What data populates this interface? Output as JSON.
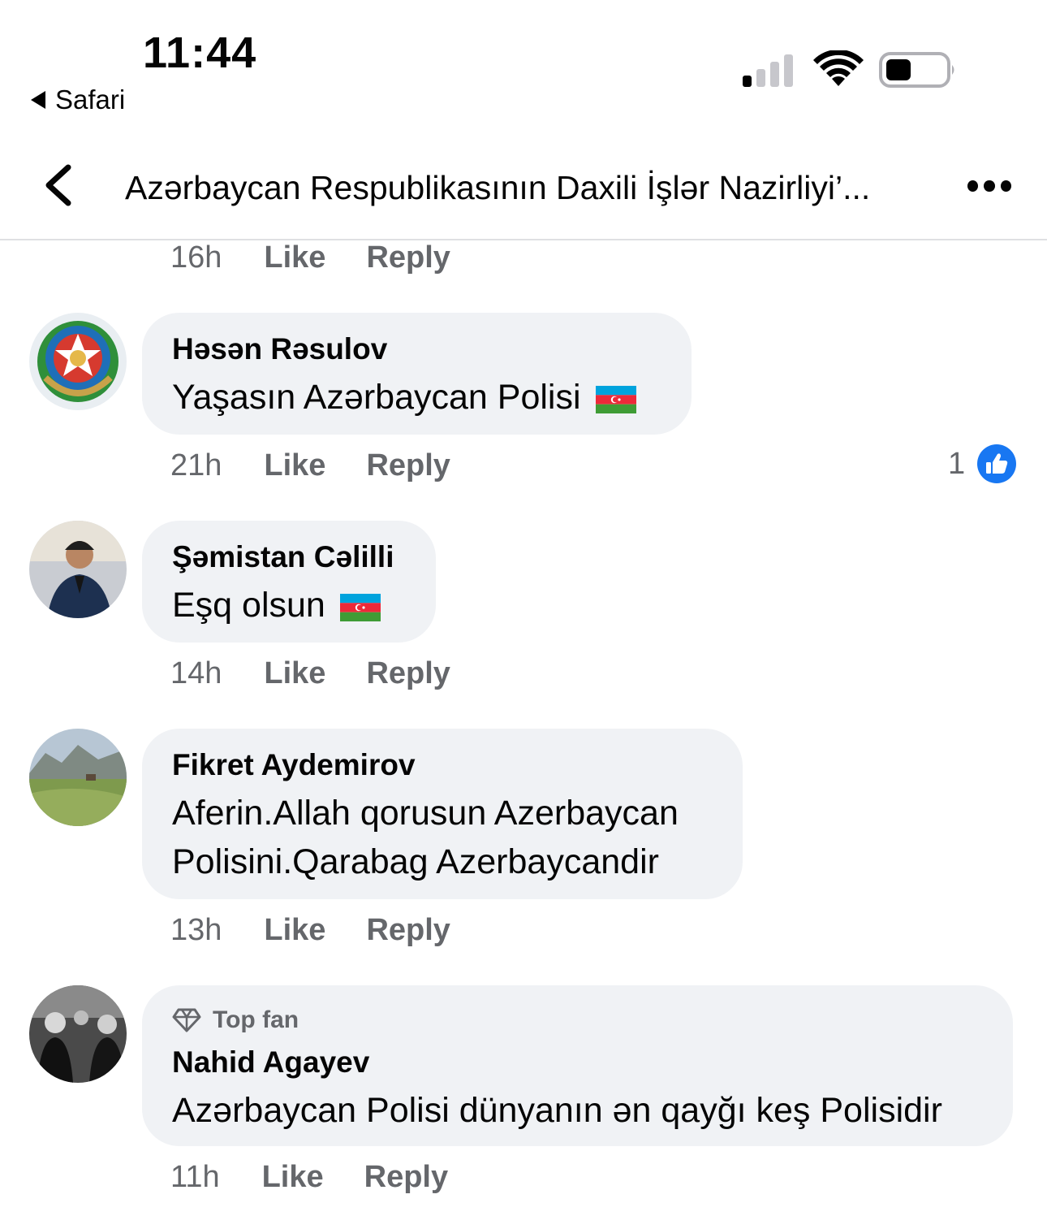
{
  "status_bar": {
    "time": "11:44",
    "back_app": "Safari"
  },
  "nav": {
    "title": "Azərbaycan Respublikasının Daxili İşlər Nazirliyi’..."
  },
  "actions": {
    "like": "Like",
    "reply": "Reply"
  },
  "first_meta": {
    "time": "16h"
  },
  "comments": [
    {
      "author": "Həsən Rəsulov",
      "text": "Yaşasın Azərbaycan Polisi",
      "time": "21h",
      "reaction_count": "1"
    },
    {
      "author": "Şəmistan Cəlilli",
      "text": "Eşq olsun",
      "time": "14h"
    },
    {
      "author": "Fikret Aydemirov",
      "text_line1": "Aferin.Allah qorusun Azerbaycan",
      "text_line2": "Polisini.Qarabag Azerbaycandir",
      "time": "13h"
    },
    {
      "badge": "Top fan",
      "author": "Nahid Agayev",
      "text": "Azərbaycan Polisi dünyanın ən qayğı keş Polisidir",
      "time": "11h"
    }
  ],
  "colors": {
    "bubble": "#f0f2f5",
    "meta": "#65676b",
    "like_blue": "#1877f2"
  }
}
